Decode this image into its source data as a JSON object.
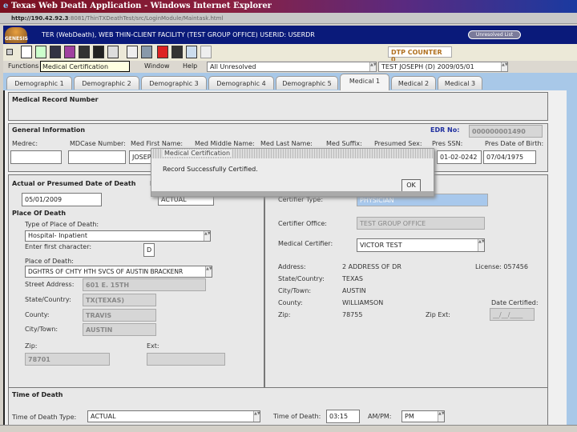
{
  "window": {
    "title": "Texas Web Death Application - Windows Internet Explorer",
    "url_host": "http://190.42.92.3",
    "url_rest": ":8081/ThinTXDeathTest/src/LoginModule/Maintask.html"
  },
  "header": {
    "logo": "GENESIS",
    "text": "TER (WebDeath), WEB THIN-CLIENT FACILITY (TEST GROUP OFFICE) USERID: USERDR",
    "unresolved_button": "Unresolved List"
  },
  "toolbar": {
    "dtp_counter": "DTP COUNTER 0",
    "icons": [
      "window-icon",
      "new-document-icon",
      "certify-icon",
      "tools-icon",
      "help-book-icon",
      "save-icon",
      "binoculars-icon",
      "report-icon",
      "microscope-icon",
      "print-icon",
      "stop-icon",
      "calculator-icon",
      "list-icon",
      "hand-icon"
    ]
  },
  "menu": {
    "items": [
      "Functions",
      "s",
      "Window",
      "Help"
    ],
    "tooltip": "Medical Certification",
    "filter_value": "All Unresolved",
    "record_value": "TEST JOSEPH (D) 2009/05/01"
  },
  "tabs": [
    "Demographic 1",
    "Demographic 2",
    "Demographic 3",
    "Demographic 4",
    "Demographic 5",
    "Medical 1",
    "Medical 2",
    "Medical 3"
  ],
  "active_tab": "Medical 1",
  "medical_record": {
    "title": "Medical Record Number"
  },
  "general": {
    "title": "General Information",
    "edr_label": "EDR No:",
    "edr_value": "000000001490",
    "fields": [
      {
        "label": "Medrec:",
        "value": ""
      },
      {
        "label": "MDCase Number:",
        "value": ""
      },
      {
        "label": "Med First Name:",
        "value": "JOSEPH"
      },
      {
        "label": "Med Middle Name:",
        "value": ""
      },
      {
        "label": "Med Last Name:",
        "value": ""
      },
      {
        "label": "Med Suffix:",
        "value": ""
      },
      {
        "label": "Presumed Sex:",
        "value": ""
      },
      {
        "label": "Pres SSN:",
        "value": "01-02-0242"
      },
      {
        "label": "Pres Date of Birth:",
        "value": "07/04/1975"
      }
    ]
  },
  "death_date": {
    "title": "Actual or Presumed Date of Death",
    "title2": "D",
    "date": "05/01/2009",
    "type": "ACTUAL"
  },
  "place": {
    "title": "Place Of Death",
    "type_label": "Type of Place of Death:",
    "type_value": "Hospital- Inpatient",
    "first_char_label": "Enter first character:",
    "first_char_value": "D",
    "place_label": "Place of Death:",
    "place_value": "DGHTRS OF CHTY HTH SVCS OF AUSTIN BRACKENR",
    "street_label": "Street Address:",
    "street": "601 E. 15TH",
    "state_label": "State/Country:",
    "state": "TX(TEXAS)",
    "county_label": "County:",
    "county": "TRAVIS",
    "city_label": "City/Town:",
    "city": "AUSTIN",
    "zip_label": "Zip:",
    "zip": "78701",
    "ext_label": "Ext:",
    "ext": ""
  },
  "certifier": {
    "type_label": "Certifier Type:",
    "type_value": "PHYSICIAN",
    "office_label": "Certifier Office:",
    "office": "TEST GROUP OFFICE",
    "med_cert_label": "Medical Certifier:",
    "med_cert": "VICTOR TEST",
    "address_label": "Address:",
    "address": "2 ADDRESS OF DR",
    "license": "License: 057456",
    "state_label": "State/Country:",
    "state": "TEXAS",
    "city_label": "City/Town:",
    "city": "AUSTIN",
    "county_label": "County:",
    "county": "WILLIAMSON",
    "zip_label": "Zip:",
    "zip": "78755",
    "zipext_label": "Zip Ext:",
    "date_cert_label": "Date Certified:",
    "date_cert": "__/__/____"
  },
  "time": {
    "title": "Time of Death",
    "type_label": "Time of Death Type:",
    "type_value": "ACTUAL",
    "time_label": "Time of Death:",
    "time_value": "03:15",
    "ampm_label": "AM/PM:",
    "ampm_value": "PM"
  },
  "dialog": {
    "title": "Medical Certification",
    "message": "Record Successfully Certified.",
    "ok": "OK"
  }
}
